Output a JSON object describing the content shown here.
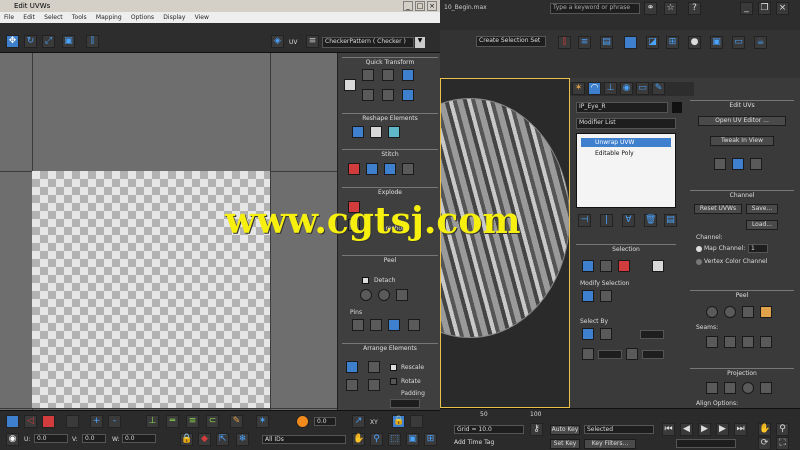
{
  "uvw_window": {
    "title": "Edit UVWs",
    "menu": [
      "File",
      "Edit",
      "Select",
      "Tools",
      "Mapping",
      "Options",
      "Display",
      "View"
    ],
    "uv_label": "UV",
    "texture_dropdown": "CheckerPattern ( Checker )",
    "panels": {
      "quick_transform": "Quick Transform",
      "reshape": "Reshape Elements",
      "stitch": "Stitch",
      "explode": "Explode",
      "threshold": "Threshold",
      "peel": "Peel",
      "detach": "Detach",
      "pins": "Pins",
      "arrange": "Arrange Elements",
      "rescale": "Rescale",
      "rotate": "Rotate",
      "padding": "Padding"
    },
    "bottom": {
      "u_label": "U:",
      "u_value": "0.0",
      "v_label": "V:",
      "v_value": "0.0",
      "w_label": "W:",
      "w_value": "0.0",
      "all_ids": "All IDs",
      "zoom_value": "0.0",
      "xy_label": "XY"
    }
  },
  "max_window": {
    "file_title": "10_Begin.max",
    "search_placeholder": "Type a keyword or phrase",
    "selection_set": "Create Selection Set",
    "command_panel": {
      "object_name": "IP_Eye_R",
      "modifier_list": "Modifier List",
      "stack": [
        "Unwrap UVW",
        "Editable Poly"
      ],
      "edit_uvs": "Edit UVs",
      "open_uv_editor": "Open UV Editor ...",
      "tweak_in_view": "Tweak In View",
      "channel": "Channel",
      "reset_uvws": "Reset UVWs",
      "save": "Save...",
      "load": "Load...",
      "channel_label": "Channel:",
      "map_channel": "Map Channel:",
      "map_channel_value": "1",
      "vertex_color_channel": "Vertex Color Channel",
      "selection": "Selection",
      "modify_selection": "Modify Selection",
      "select_by": "Select By",
      "peel": "Peel",
      "seams": "Seams:",
      "projection": "Projection",
      "align_options": "Align Options:"
    },
    "bottom": {
      "grid": "Grid = 10.0",
      "auto_key": "Auto Key",
      "set_key": "Set Key",
      "selected": "Selected",
      "key_filters": "Key Filters...",
      "add_time_tag": "Add Time Tag",
      "ruler_50": "50",
      "ruler_100": "100"
    }
  },
  "watermark": "www.cgtsj.com"
}
